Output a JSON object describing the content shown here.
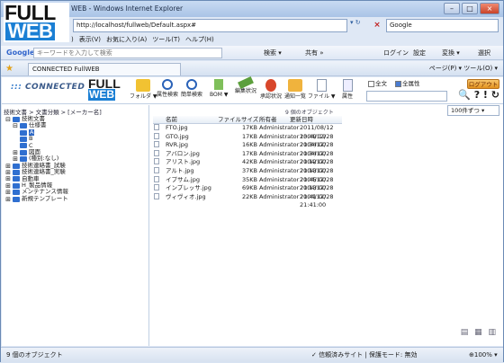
{
  "window": {
    "title": "WEB - Windows Internet Explorer",
    "min": "–",
    "max": "□",
    "close": "×"
  },
  "logo": {
    "line1": "FULL",
    "line2": "WEB"
  },
  "address": {
    "url": "http://localhost/fullweb/Default.aspx#",
    "search_placeholder": "Google"
  },
  "menu": [
    "表示(V)",
    "お気に入り(A)",
    "ツール(T)",
    "ヘルプ(H)"
  ],
  "menu_prefix": ")",
  "google_bar": {
    "label": "Google",
    "placeholder": "キーワードを入力して検索",
    "search": "検索 ▾",
    "extra": "共有 »",
    "login": "ログイン",
    "settings": "設定",
    "translate": "変換 ▾",
    "select": "選択"
  },
  "tab": {
    "label": "CONNECTED FullWEB",
    "right": "ページ(P) ▾  ツール(O) ▾"
  },
  "app": {
    "connected_logo": "CONNECTED",
    "logo1": "FULL",
    "logo2": "WEB",
    "toolbar": [
      "フォルダ ▼",
      "属性検索",
      "簡単検索",
      "BOM ▼",
      "編集状況",
      "承認状況",
      "通知一覧",
      "ファイル ▼",
      "属性"
    ],
    "chk_all": "全文",
    "chk_attr": "全属性",
    "logout": "ログアウト",
    "help_icons": "🔍 ? ! ↻"
  },
  "left": {
    "breadcrumb": "技術文書 > 文書分類 > [メーカー名]",
    "tree": [
      {
        "pm": "⊟",
        "label": "技術文書",
        "lvl": 0
      },
      {
        "pm": "⊟",
        "label": "仕様書",
        "lvl": 1
      },
      {
        "pm": "",
        "label": "A",
        "lvl": 2,
        "sel": true
      },
      {
        "pm": "",
        "label": "B",
        "lvl": 2
      },
      {
        "pm": "",
        "label": "C",
        "lvl": 2
      },
      {
        "pm": "⊞",
        "label": "図面",
        "lvl": 1
      },
      {
        "pm": "⊞",
        "label": "(種別:なし)",
        "lvl": 1
      },
      {
        "pm": "⊞",
        "label": "技術連絡書_試験",
        "lvl": 0
      },
      {
        "pm": "⊞",
        "label": "技術連絡書_実験",
        "lvl": 0
      },
      {
        "pm": "⊞",
        "label": "自動車",
        "lvl": 0
      },
      {
        "pm": "⊞",
        "label": "H_製品情報",
        "lvl": 0
      },
      {
        "pm": "⊞",
        "label": "メンテナンス情報",
        "lvl": 0
      },
      {
        "pm": "⊞",
        "label": "新規テンプレート",
        "lvl": 0
      }
    ]
  },
  "main": {
    "count": "9 個のオブジェクト",
    "pager": "100件ずつ ▾",
    "headers": {
      "name": "名前",
      "size": "ファイルサイズ",
      "owner": "所有者",
      "date": "更新日時"
    },
    "rows": [
      {
        "name": "FTO.jpg",
        "size": "17KB",
        "owner": "Administrator",
        "date": "2011/08/12 13:49:19"
      },
      {
        "name": "GTO.jpg",
        "size": "17KB",
        "owner": "Administrator",
        "date": "2004/12/28 21:34:00"
      },
      {
        "name": "RVR.jpg",
        "size": "16KB",
        "owner": "Administrator",
        "date": "2004/12/28 21:34:00"
      },
      {
        "name": "アバロン.jpg",
        "size": "17KB",
        "owner": "Administrator",
        "date": "2004/12/28 21:12:00"
      },
      {
        "name": "アリスト.jpg",
        "size": "42KB",
        "owner": "Administrator",
        "date": "2004/12/28 21:13:00"
      },
      {
        "name": "アルト.jpg",
        "size": "37KB",
        "owner": "Administrator",
        "date": "2004/12/28 21:45:00"
      },
      {
        "name": "イプサム.jpg",
        "size": "35KB",
        "owner": "Administrator",
        "date": "2004/12/28 21:13:00"
      },
      {
        "name": "インプレッサ.jpg",
        "size": "69KB",
        "owner": "Administrator",
        "date": "2004/12/28 21:41:00"
      },
      {
        "name": "ヴィヴィオ.jpg",
        "size": "22KB",
        "owner": "Administrator",
        "date": "2004/12/28 21:41:00"
      }
    ],
    "view_icons": "▤ ▦ ▥"
  },
  "status": {
    "left": "9 個のオブジェクト",
    "middle": "✓ 信頼済みサイト | 保護モード: 無効",
    "zoom": "⊕100% ▾"
  }
}
